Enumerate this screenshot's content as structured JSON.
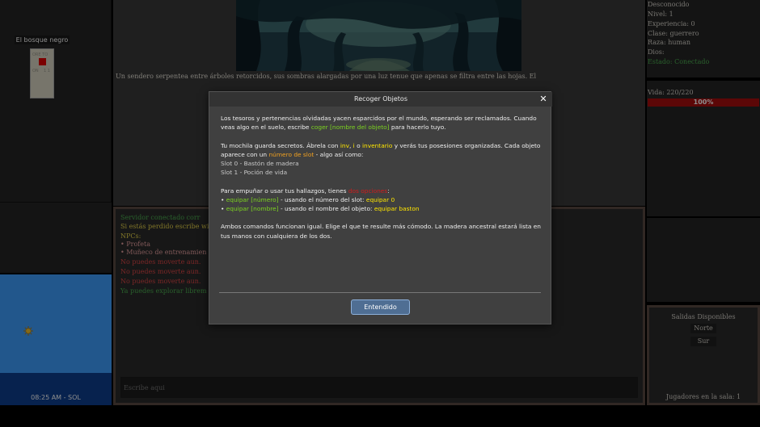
{
  "map": {
    "title": "El bosque negro",
    "faint_labels": [
      "ORE TO",
      "ON",
      "1 1"
    ]
  },
  "scene": {
    "description": "Un sendero serpentea entre árboles retorcidos, sus sombras alargadas por una luz tenue que apenas se filtra entre las hojas. El"
  },
  "time": {
    "clock": "08:25 AM - SOL",
    "sky_color": "#3f9fff"
  },
  "status": {
    "name": "Desconocido",
    "level": "Nivel: 1",
    "experience": "Experiencia: 0",
    "class": "Clase: guerrero",
    "race": "Raza: human",
    "god": "Dios:",
    "state": "Estado: Conectado"
  },
  "health": {
    "label": "Vida: 220/220",
    "percent_text": "100%",
    "fraction": 1.0
  },
  "chat": {
    "lines": [
      {
        "text": "Servidor conectado corr",
        "color": "green"
      },
      {
        "text": "Si estás perdido escribe wi",
        "color": "yellow"
      },
      {
        "text": "NPCs:",
        "color": "yellow"
      },
      {
        "text": "• Profeta",
        "color": "pink"
      },
      {
        "text": "• Muñeco de entrenamien",
        "color": "pink"
      },
      {
        "text": "No puedes moverte aun.",
        "color": "red"
      },
      {
        "text": "No puedes moverte aun.",
        "color": "red"
      },
      {
        "text": "No puedes moverte aun.",
        "color": "red"
      },
      {
        "text": "Ya puedes explorar librem",
        "color": "green"
      }
    ],
    "input_placeholder": "Escribe aqui"
  },
  "exits": {
    "title": "Salidas Disponibles",
    "items": [
      "Norte",
      "Sur"
    ],
    "players": "Jugadores en la sala: 1"
  },
  "modal": {
    "title": "Recoger Objetos",
    "p1_a": "Los tesoros y pertenencias olvidadas yacen esparcidos por el mundo, esperando ser reclamados. Cuando veas algo en el suelo, escribe ",
    "p1_cmd": "coger [nombre del objeto]",
    "p1_b": " para hacerlo tuyo.",
    "p2_a": "Tu mochila guarda secretos. Ábrela con ",
    "p2_inv": "inv",
    "p2_sep1": ", ",
    "p2_i": "i",
    "p2_sep2": " o ",
    "p2_inventario": "inventario",
    "p2_b": " y verás tus posesiones organizadas. Cada objeto aparece con un ",
    "p2_slot": "número de slot",
    "p2_c": " - algo así como:",
    "slot0": "Slot 0 - Bastón de madera",
    "slot1": "Slot 1 - Poción de vida",
    "p3_a": "Para empuñar o usar tus hallazgos, tienes ",
    "p3_red": "dos opciones",
    "p3_b": ":",
    "b1_bullet": "• ",
    "b1_cmd": "equipar [número]",
    "b1_mid": " - usando el número del slot: ",
    "b1_ex": "equipar 0",
    "b2_bullet": "• ",
    "b2_cmd": "equipar [nombre]",
    "b2_mid": " - usando el nombre del objeto: ",
    "b2_ex": "equipar baston",
    "p4": "Ambos comandos funcionan igual. Elige el que te resulte más cómodo. La madera ancestral estará lista en tus manos con cualquiera de los dos.",
    "ok_label": "Entendido",
    "close_glyph": "✕"
  }
}
